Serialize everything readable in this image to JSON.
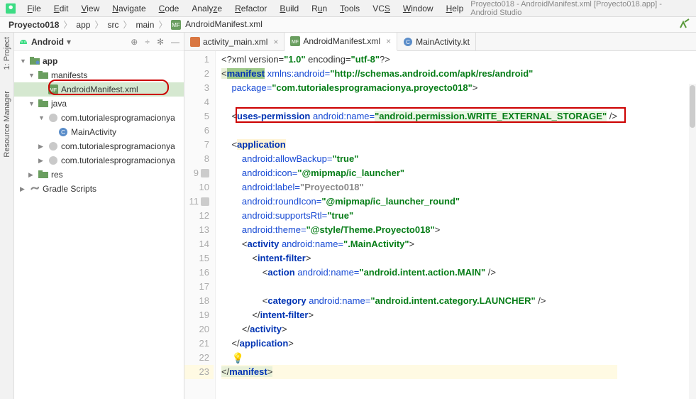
{
  "window": {
    "title": "Proyecto018 - AndroidManifest.xml [Proyecto018.app] - Android Studio"
  },
  "menubar": [
    "File",
    "Edit",
    "View",
    "Navigate",
    "Code",
    "Analyze",
    "Refactor",
    "Build",
    "Run",
    "Tools",
    "VCS",
    "Window",
    "Help"
  ],
  "breadcrumb": {
    "project": "Proyecto018",
    "items": [
      "app",
      "src",
      "main"
    ],
    "file": "AndroidManifest.xml"
  },
  "left_rail": {
    "project": "1: Project",
    "resource_mgr": "Resource Manager"
  },
  "panel": {
    "dropdown": "Android"
  },
  "tree": {
    "app": "app",
    "manifests": "manifests",
    "manifest_file": "AndroidManifest.xml",
    "java": "java",
    "pkg1": "com.tutorialesprogramacionya",
    "main_activity": "MainActivity",
    "pkg2": "com.tutorialesprogramacionya",
    "pkg3": "com.tutorialesprogramacionya",
    "res": "res",
    "gradle": "Gradle Scripts"
  },
  "tabs": [
    {
      "label": "activity_main.xml",
      "icon": "layout"
    },
    {
      "label": "AndroidManifest.xml",
      "icon": "mf",
      "active": true
    },
    {
      "label": "MainActivity.kt",
      "icon": "kt"
    }
  ],
  "code": {
    "l1_pre": "<?xml version=",
    "l1_v1": "\"1.0\"",
    "l1_mid": " encoding=",
    "l1_v2": "\"utf-8\"",
    "l1_end": "?>",
    "l2_tag": "manifest",
    "l2_attr": " xmlns:android=",
    "l2_val": "\"http://schemas.android.com/apk/res/android\"",
    "l3_attr": "package=",
    "l3_val": "\"com.tutorialesprogramacionya.proyecto018\"",
    "l3_end": ">",
    "l5_tag": "uses-permission",
    "l5_attr": "android:name=",
    "l5_val": "\"android.permission.WRITE_EXTERNAL_STORAGE\"",
    "l5_end": " />",
    "l7_tag": "application",
    "l8_attr": "android:allowBackup=",
    "l8_val": "\"true\"",
    "l9_attr": "android:icon=",
    "l9_val": "\"@mipmap/ic_launcher\"",
    "l10_attr": "android:label=",
    "l10_val": "\"Proyecto018\"",
    "l11_attr": "android:roundIcon=",
    "l11_val": "\"@mipmap/ic_launcher_round\"",
    "l12_attr": "android:supportsRtl=",
    "l12_val": "\"true\"",
    "l13_attr": "android:theme=",
    "l13_val": "\"@style/Theme.Proyecto018\"",
    "l13_end": ">",
    "l14_tag": "activity",
    "l14_attr": "android:name=",
    "l14_val": "\".MainActivity\"",
    "l14_end": ">",
    "l15_tag": "intent-filter",
    "l15_end": ">",
    "l16_tag": "action",
    "l16_attr": "android:name=",
    "l16_val": "\"android.intent.action.MAIN\"",
    "l16_end": " />",
    "l18_tag": "category",
    "l18_attr": "android:name=",
    "l18_val": "\"android.intent.category.LAUNCHER\"",
    "l18_end": " />",
    "l19_close": "intent-filter",
    "l20_close": "activity",
    "l21_close": "application",
    "l23_close": "manifest"
  },
  "line_numbers": [
    "1",
    "2",
    "3",
    "4",
    "5",
    "6",
    "7",
    "8",
    "9",
    "10",
    "11",
    "12",
    "13",
    "14",
    "15",
    "16",
    "17",
    "18",
    "19",
    "20",
    "21",
    "22",
    "23"
  ]
}
